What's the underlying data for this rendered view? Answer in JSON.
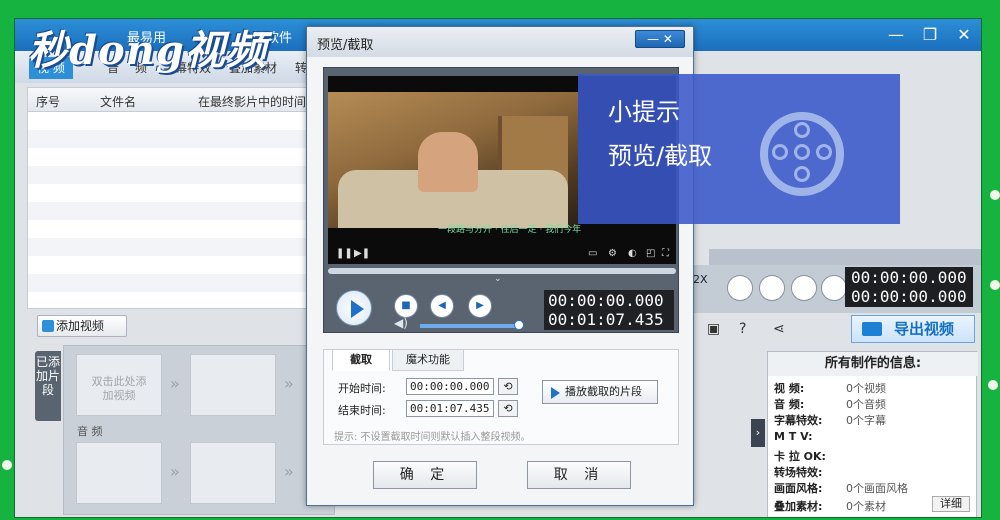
{
  "app": {
    "logo": "秒dong视频",
    "menu_items": [
      "最易用",
      "辑软件"
    ],
    "window_controls": [
      "—",
      "❐",
      "✕"
    ],
    "tabs": [
      "视 频",
      "音",
      "频",
      "字幕特效",
      "叠加素材",
      "转"
    ],
    "file_list": {
      "columns": [
        "序号",
        "文件名",
        "在最终影片中的时间"
      ]
    },
    "add_video_label": "添加视频",
    "side_tab_label": "已添加片段",
    "timeline": {
      "slot_hint": "双击此处添加视频",
      "audio_label": "音 频"
    },
    "right_timecode": [
      "00:00:00.000",
      "00:00:00.000"
    ],
    "right_speed": "2X",
    "export_label": "导出视频",
    "info_panel": {
      "title": "所有制作的信息:",
      "rows": [
        {
          "k": "视    频:",
          "v": "0个视频"
        },
        {
          "k": "音    频:",
          "v": "0个音频"
        },
        {
          "k": "字幕特效:",
          "v": "0个字幕"
        },
        {
          "k": "M  T  V:",
          "v": ""
        },
        {
          "k": "卡 拉 OK:",
          "v": ""
        },
        {
          "k": "转场特效:",
          "v": ""
        },
        {
          "k": "画面风格:",
          "v": "0个画面风格"
        },
        {
          "k": "叠加素材:",
          "v": "0个素材"
        }
      ],
      "detail_label": "详细"
    }
  },
  "dialog": {
    "title": "预览/截取",
    "min_close": "—  ✕",
    "subtitle_text": "一段路与分开 · 往后一走 · 我们今年",
    "timecode": [
      "00:00:00.000",
      "00:01:07.435"
    ],
    "tabs": [
      "截取",
      "魔术功能"
    ],
    "start_label": "开始时间:",
    "start_value": "00:00:00.000",
    "end_label": "结束时间:",
    "end_value": "00:01:07.435",
    "play_segment_label": "播放截取的片段",
    "hint": "提示: 不设置截取时间则默认插入整段视频。",
    "ok_label": "确 定",
    "cancel_label": "取 消"
  },
  "overlay": {
    "line1": "小提示",
    "line2": "预览/截取"
  }
}
